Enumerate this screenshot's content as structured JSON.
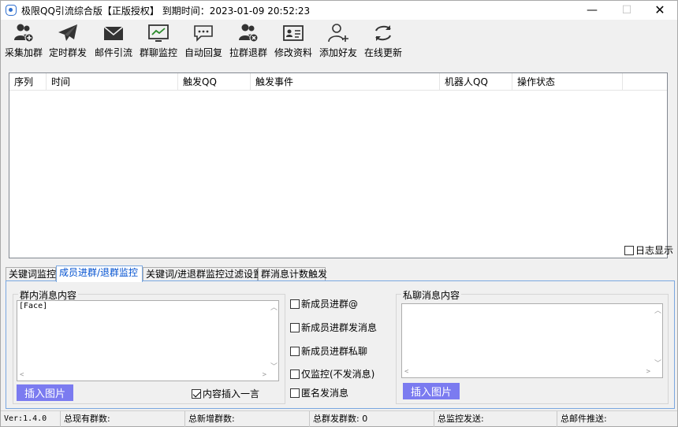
{
  "window": {
    "title": "极限QQ引流综合版【正版授权】 到期时间：2023-01-09 20:52:23",
    "minimize": "—",
    "maximize": "☐",
    "close": "✕"
  },
  "toolbar": [
    {
      "label": "采集加群",
      "icon": "users-add-icon"
    },
    {
      "label": "定时群发",
      "icon": "paper-plane-icon"
    },
    {
      "label": "邮件引流",
      "icon": "envelope-icon"
    },
    {
      "label": "群聊监控",
      "icon": "monitor-chart-icon"
    },
    {
      "label": "自动回复",
      "icon": "chat-bubble-icon"
    },
    {
      "label": "拉群退群",
      "icon": "users-remove-icon"
    },
    {
      "label": "修改资料",
      "icon": "id-card-icon"
    },
    {
      "label": "添加好友",
      "icon": "user-add-icon"
    },
    {
      "label": "在线更新",
      "icon": "refresh-icon"
    }
  ],
  "log_table": {
    "columns": [
      "序列",
      "时间",
      "触发QQ",
      "触发事件",
      "机器人QQ",
      "操作状态"
    ],
    "rows": [],
    "log_display_label": "日志显示",
    "log_display_checked": false
  },
  "tabs": [
    {
      "label": "关键词监控",
      "active": false
    },
    {
      "label": "成员进群/退群监控",
      "active": true
    },
    {
      "label": "关键词/进退群监控过滤设置",
      "active": false
    },
    {
      "label": "群消息计数触发",
      "active": false
    }
  ],
  "group_msg": {
    "title": "群内消息内容",
    "value": "[Face]",
    "insert_image": "插入图片",
    "insert_quote_label": "内容插入一言",
    "insert_quote_checked": true
  },
  "options": [
    {
      "label": "新成员进群@",
      "checked": false
    },
    {
      "label": "新成员进群发消息",
      "checked": false
    },
    {
      "label": "新成员进群私聊",
      "checked": false
    },
    {
      "label": "仅监控(不发消息)",
      "checked": false
    },
    {
      "label": "匿名发消息",
      "checked": false
    }
  ],
  "private_msg": {
    "title": "私聊消息内容",
    "value": "",
    "insert_image": "插入图片"
  },
  "status_bar": {
    "version": "Ver:1.4.0",
    "total_groups": "总现有群数:",
    "total_new_groups": "总新增群数:",
    "total_broadcast": "总群发群数: 0",
    "total_monitor_send": "总监控发送:",
    "total_mail_push": "总邮件推送:"
  }
}
